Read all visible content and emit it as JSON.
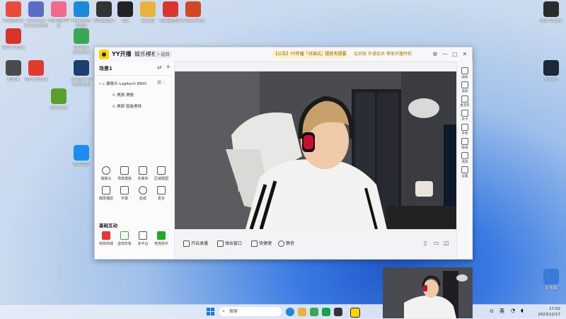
{
  "desktop_icons": [
    {
      "label": "YY语音Win",
      "color": "#e94b3c"
    },
    {
      "label": "Windows Screenshots",
      "color": "#5b6cc7"
    },
    {
      "label": "PDF软件中心",
      "color": "#f06a8c"
    },
    {
      "label": "Microsoft Edge",
      "color": "#1c8ad8"
    },
    {
      "label": "Wallpaper",
      "color": "#333333"
    },
    {
      "label": "QQ",
      "color": "#222222"
    },
    {
      "label": "Assets",
      "color": "#e8b33b"
    },
    {
      "label": "网易云音乐",
      "color": "#d8372f"
    },
    {
      "label": "PowerPoint",
      "color": "#d24726"
    },
    {
      "label": "WPS Office",
      "color": "#d7342b"
    },
    {
      "label": "Google Chrome",
      "color": "#3aa757"
    },
    {
      "label": "KOOK",
      "color": "#4b4b4b"
    },
    {
      "label": "WPS Office",
      "color": "#e23a2c"
    },
    {
      "label": "League of Legends",
      "color": "#1d3f6e"
    },
    {
      "label": "GeForce",
      "color": "#5aa02c"
    },
    {
      "label": "腾讯会议",
      "color": "#1d8cf0"
    },
    {
      "label": "OBS Studio",
      "color": "#2b2b2b"
    },
    {
      "label": "Steam",
      "color": "#1b2838"
    },
    {
      "label": "此电脑",
      "color": "#3a79d6"
    }
  ],
  "window": {
    "app_name": "YY开播",
    "mode": "娱乐模板",
    "badge": "• 返回",
    "notice": "【公告】YY开播「对调试」提前有提要",
    "member": "会员版  开通会员 尊享开播特权",
    "controls": [
      "⚙",
      "—",
      "▢",
      "✕"
    ]
  },
  "left_panel": {
    "scene_title": "场景1",
    "sources": [
      {
        "label": "摄像头-Logitech BRIO"
      },
      {
        "label": "美颜-美肤"
      },
      {
        "label": "美颜-智能美体"
      }
    ],
    "tools_row1": [
      "摄像头",
      "场景模板",
      "多媒体",
      "区域截图"
    ],
    "tools_row2": [
      "截屏捕捉",
      "字幕",
      "贴纸",
      "更多"
    ],
    "interactive_title": "基础互动",
    "interactive": [
      "特效商城",
      "虚拟形象",
      "多平台",
      "电竞助手"
    ]
  },
  "right_bar": [
    "画质",
    "美颜",
    "麦克风",
    "声卡",
    "手势",
    "贴纸",
    "道具",
    "设置"
  ],
  "bottom_bar": [
    "开启录播",
    "弹出窗口",
    "快捷键",
    "静音"
  ],
  "taskbar": {
    "search_placeholder": "搜索",
    "time": "17:02",
    "date": "2023/12/17",
    "lang": "英"
  }
}
